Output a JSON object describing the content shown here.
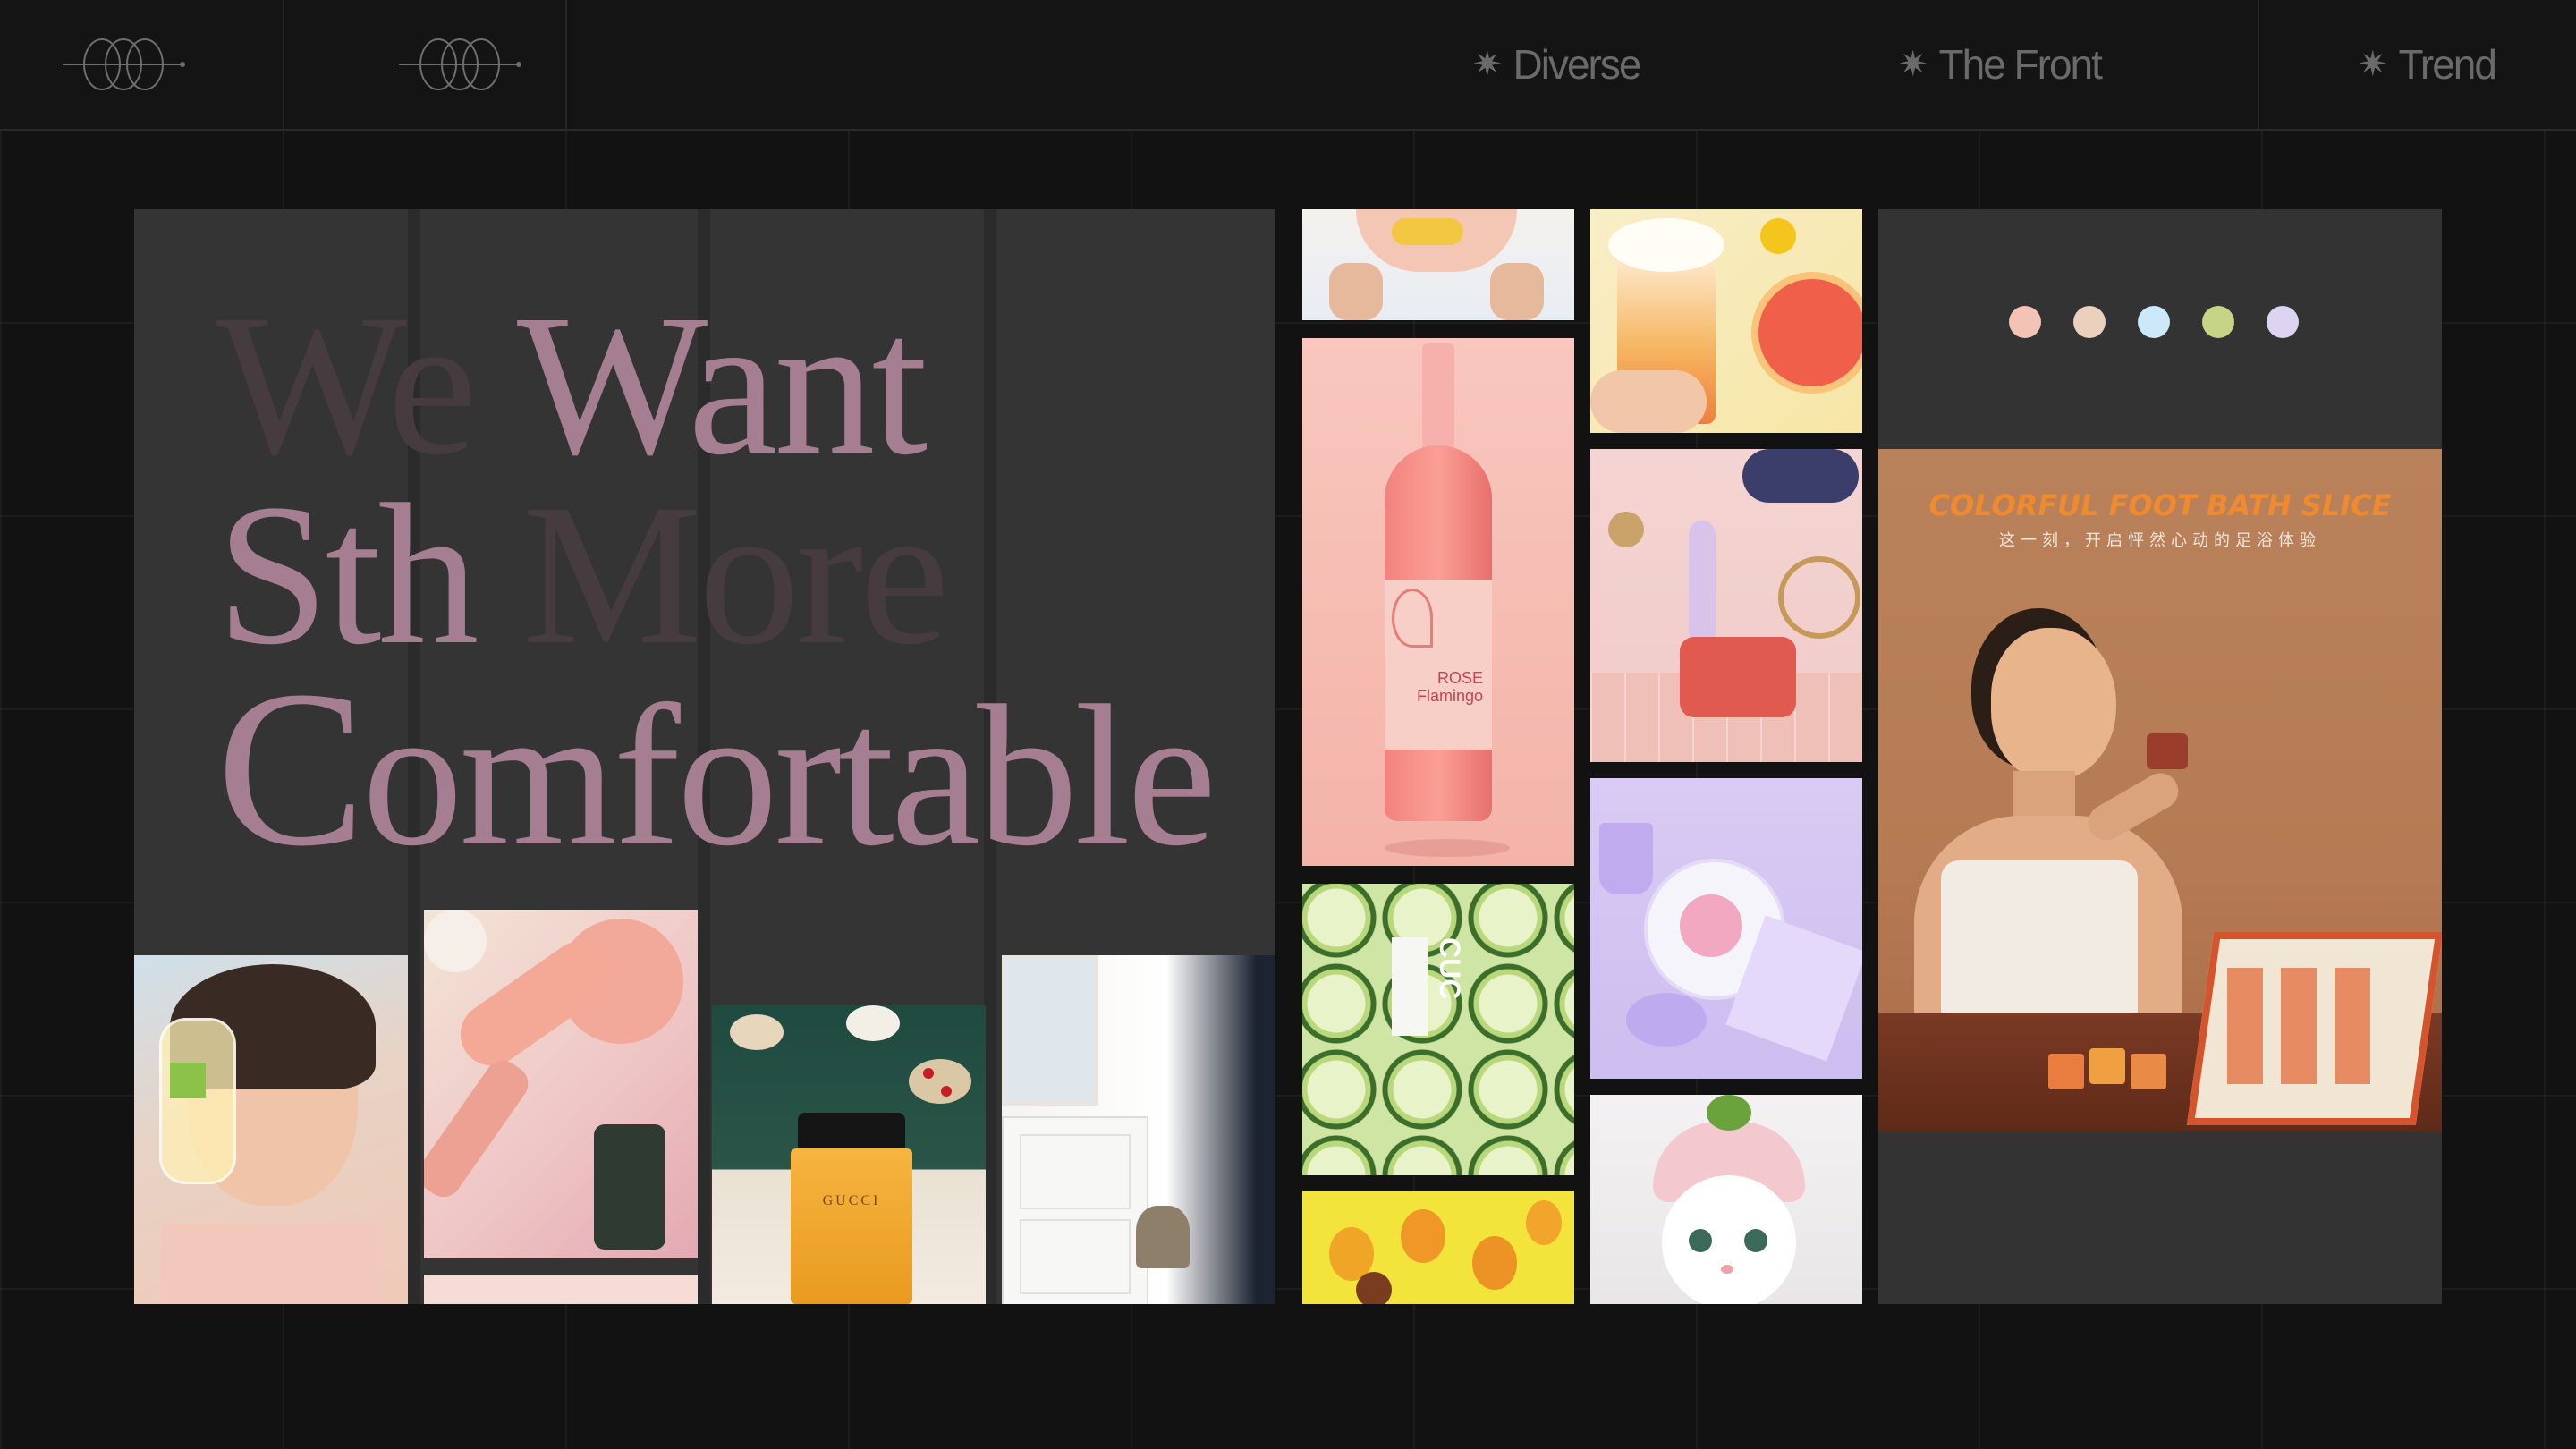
{
  "nav": {
    "items": [
      {
        "label": "Diverse",
        "icon": "sparkle-icon"
      },
      {
        "label": "The Front",
        "icon": "sparkle-icon"
      },
      {
        "label": "Trend",
        "icon": "sparkle-icon"
      }
    ]
  },
  "headline": {
    "line1_dim": "We",
    "line1_pink": "Want",
    "line2_pink": "Sth",
    "line2_dim": "More",
    "line3_first": "C",
    "line3_rest": "omfortable"
  },
  "palette": {
    "swatches": [
      "#f3c3b6",
      "#ead0bd",
      "#cbe9f9",
      "#c6d486",
      "#ddd4f1"
    ]
  },
  "poster": {
    "title": "COLORFUL FOOT BATH SLICE",
    "subtitle": "这一刻，开启怦然心动的足浴体验"
  },
  "photos": {
    "bottle_label_1": "ROSE",
    "bottle_label_2": "Flamingo",
    "cucumber_label": "CUC",
    "perfume_label": "GUCCI"
  },
  "colors": {
    "accent_pink": "#a57f91",
    "poster_orange": "#f08a2e"
  }
}
